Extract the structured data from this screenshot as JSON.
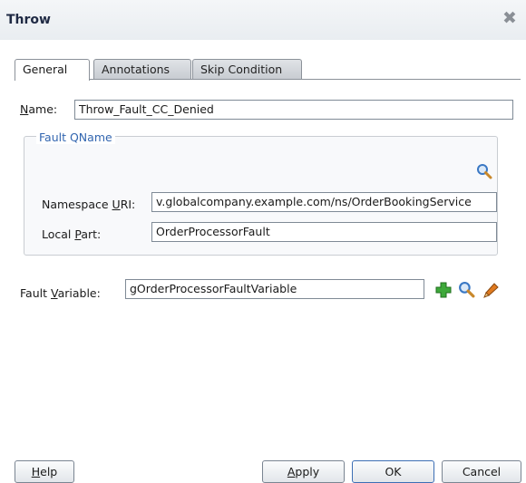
{
  "dialog": {
    "title": "Throw"
  },
  "tabs": [
    {
      "label": "General"
    },
    {
      "label": "Annotations"
    },
    {
      "label": "Skip Condition"
    }
  ],
  "fields": {
    "name": {
      "label_mnemonic": "N",
      "label_rest": "ame:",
      "value": "Throw_Fault_CC_Denied"
    },
    "fault_qname": {
      "legend": "Fault QName",
      "namespace": {
        "label_pre": "Namespace ",
        "label_mnemonic": "U",
        "label_post": "RI:",
        "value": "v.globalcompany.example.com/ns/OrderBookingService"
      },
      "local_part": {
        "label_pre": "Local ",
        "label_mnemonic": "P",
        "label_post": "art:",
        "value": "OrderProcessorFault"
      }
    },
    "fault_variable": {
      "label_pre": "Fault ",
      "label_mnemonic": "V",
      "label_post": "ariable:",
      "value": "gOrderProcessorFaultVariable"
    }
  },
  "buttons": {
    "help": {
      "mnemonic": "H",
      "rest": "elp"
    },
    "apply": {
      "mnemonic": "A",
      "rest": "pply"
    },
    "ok": {
      "label": "OK"
    },
    "cancel": {
      "label": "Cancel"
    }
  },
  "colors": {
    "accent": "#3366b0",
    "add_icon": "#3ea83a",
    "search_icon": "#3a78c4",
    "edit_icon": "#e07a1f"
  },
  "icons": [
    "close-icon",
    "search-icon",
    "add-icon",
    "edit-icon"
  ]
}
